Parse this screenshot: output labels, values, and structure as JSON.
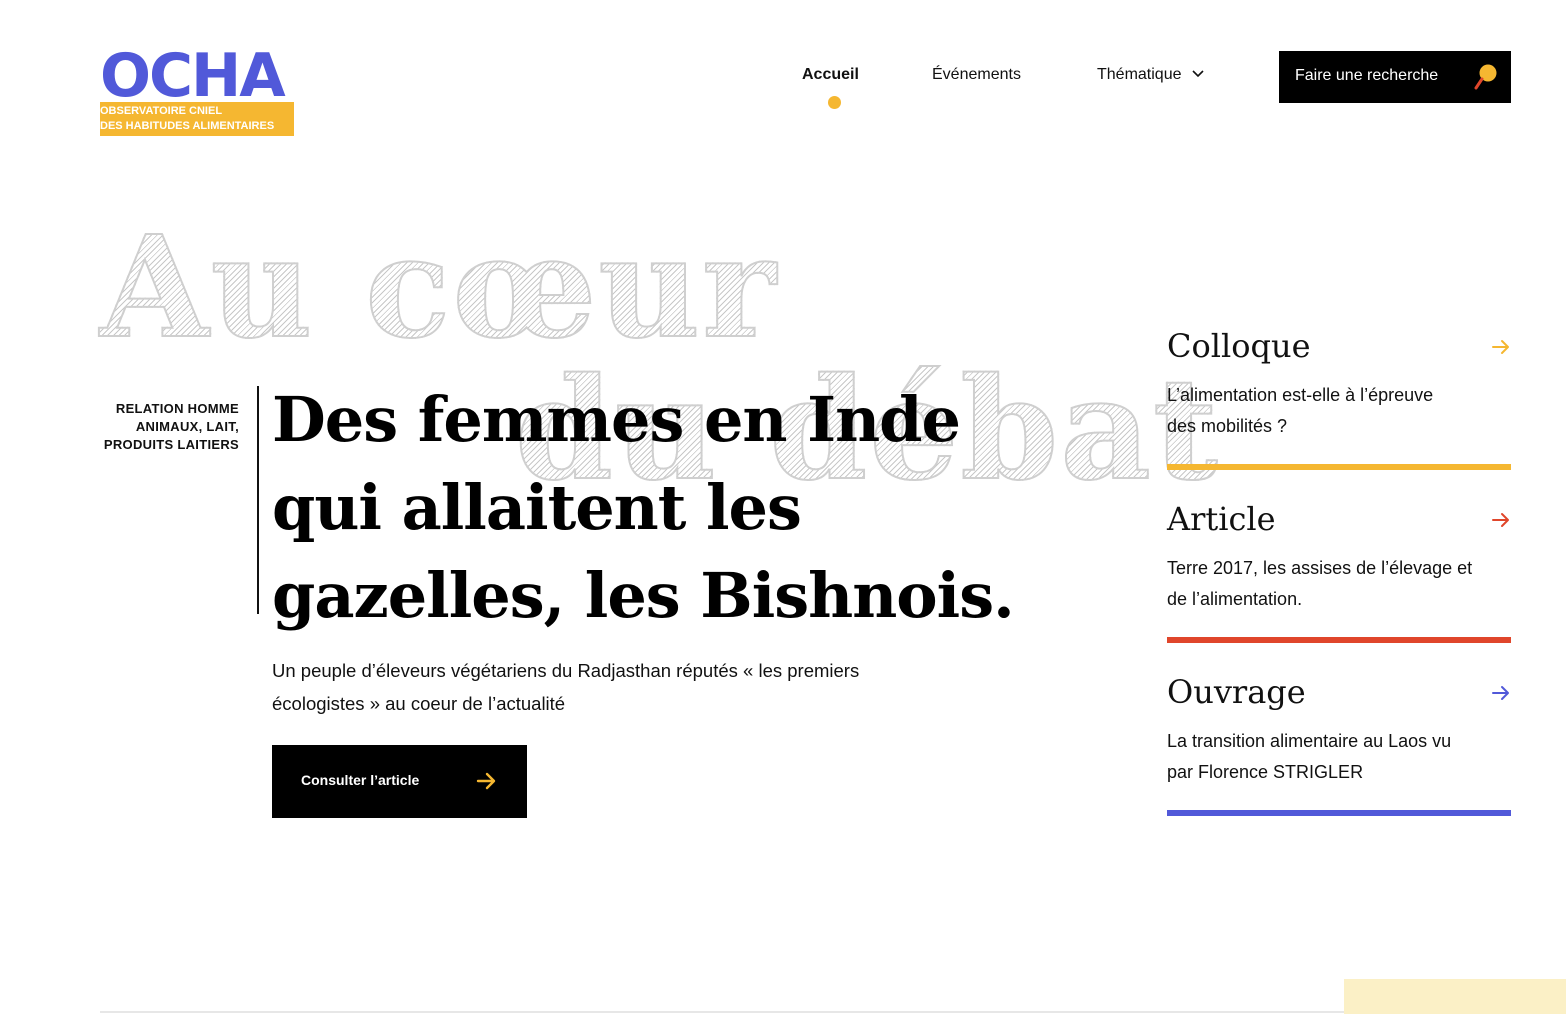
{
  "logo": {
    "word": "OCHA",
    "line1": "OBSERVATOIRE CNIEL",
    "line2": "DES HABITUDES ALIMENTAIRES"
  },
  "nav": {
    "items": [
      {
        "label": "Accueil",
        "active": true
      },
      {
        "label": "Événements"
      },
      {
        "label": "Thématique",
        "has_dropdown": true
      }
    ],
    "search_label": "Faire une recherche"
  },
  "hero": {
    "background_text_1": "Au cœur",
    "background_text_2": "du débat",
    "tag_lines": [
      "RELATION HOMME",
      "ANIMAUX, LAIT,",
      "PRODUITS LAITIERS"
    ],
    "headline_lines": [
      "Des femmes en Inde",
      "qui allaitent les",
      "gazelles, les Bishnois."
    ],
    "subtitle_lines": [
      "Un peuple d’éleveurs végétariens du Radjasthan réputés «  les premiers",
      "écologistes » au coeur de l’actualité"
    ],
    "cta_label": "Consulter l’article"
  },
  "cards": [
    {
      "title": "Colloque",
      "text_lines": [
        "L’alimentation est-elle à l’épreuve",
        "des mobilités ?"
      ],
      "color": "#f5b731"
    },
    {
      "title": "Article",
      "text_lines": [
        "Terre 2017, les assises de l’élevage et",
        "de l’alimentation."
      ],
      "color": "#e0462b"
    },
    {
      "title": "Ouvrage",
      "text_lines": [
        "La transition alimentaire au Laos vu",
        "par Florence STRIGLER"
      ],
      "color": "#5159d9"
    }
  ],
  "colors": {
    "brand_blue": "#5159d9",
    "brand_yellow": "#f5b731",
    "accent_red": "#e0462b"
  }
}
